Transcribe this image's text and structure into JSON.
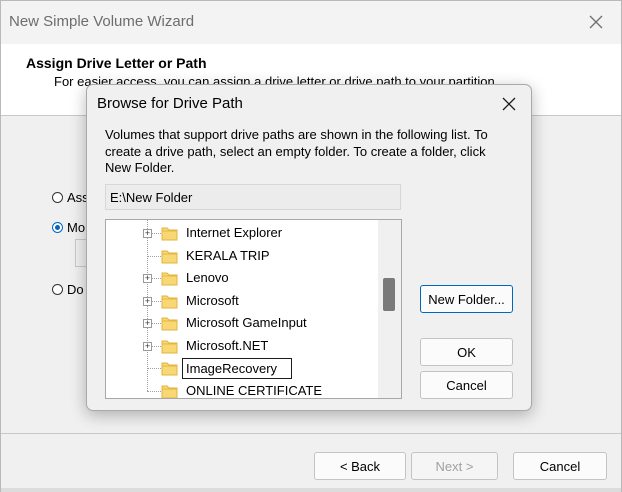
{
  "wizard": {
    "title": "New Simple Volume Wizard",
    "header_title": "Assign Drive Letter or Path",
    "header_subtitle": "For easier access, you can assign a drive letter or drive path to your partition.",
    "options": [
      {
        "label": "Ass",
        "checked": false
      },
      {
        "label": "Mo",
        "checked": true
      },
      {
        "label": "Do",
        "checked": false
      }
    ],
    "buttons": {
      "back": "< Back",
      "next": "Next >",
      "cancel": "Cancel"
    }
  },
  "dialog": {
    "title": "Browse for Drive Path",
    "description": "Volumes that support drive paths are shown in the following list. To create a drive path, select an empty folder. To create a folder, click New Folder.",
    "path_value": "E:\\New Folder",
    "tree_items": [
      {
        "label": "Internet Explorer",
        "expandable": true
      },
      {
        "label": "KERALA TRIP",
        "expandable": false
      },
      {
        "label": "Lenovo",
        "expandable": true
      },
      {
        "label": "Microsoft",
        "expandable": true
      },
      {
        "label": "Microsoft GameInput",
        "expandable": true
      },
      {
        "label": "Microsoft.NET",
        "expandable": true
      },
      {
        "label": "ImageRecovery",
        "expandable": false,
        "editing": true
      },
      {
        "label": "ONLINE CERTIFICATE",
        "expandable": false
      }
    ],
    "buttons": {
      "new_folder": "New Folder...",
      "ok": "OK",
      "cancel": "Cancel"
    }
  },
  "colors": {
    "accent": "#0067c0",
    "folder_fill": "#f8d775",
    "folder_shade": "#e8b93a"
  },
  "icons": [
    "close-icon",
    "folder-icon",
    "expand-plus-icon",
    "radio-icon"
  ]
}
